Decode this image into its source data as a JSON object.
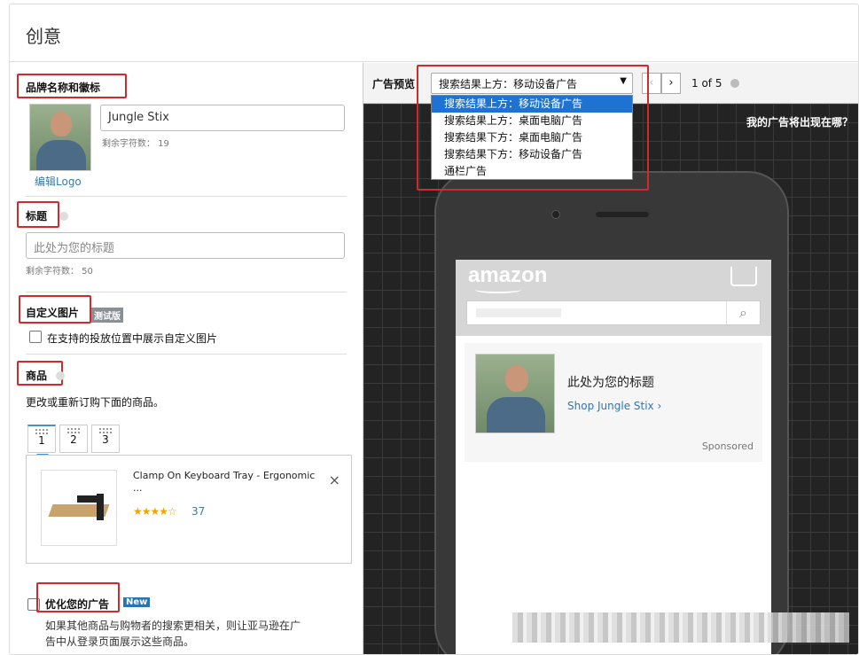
{
  "page": {
    "title": "创意"
  },
  "brand": {
    "label": "品牌名称和徽标",
    "name_value": "Jungle Stix",
    "chars_left": "剩余字符数： 19",
    "edit_logo": "编辑Logo"
  },
  "headline": {
    "label": "标题",
    "placeholder": "此处为您的标题",
    "chars_left": "剩余字符数： 50"
  },
  "custom_image": {
    "label": "自定义图片",
    "badge": "测试版",
    "checkbox_label": "在支持的投放位置中展示自定义图片"
  },
  "products": {
    "label": "商品",
    "hint": "更改或重新订购下面的商品。",
    "tabs": [
      "1",
      "2",
      "3"
    ],
    "item": {
      "title": "Clamp On Keyboard Tray - Ergonomic",
      "ellipsis": "...",
      "rating_count": "37"
    }
  },
  "optimize": {
    "label": "优化您的广告",
    "badge": "New",
    "desc_line1": "如果其他商品与购物者的搜索更相关，则让亚马逊在广",
    "desc_line2": "告中从登录页面展示这些商品。"
  },
  "preview": {
    "label": "广告预览",
    "selected": "搜索结果上方：移动设备广告",
    "options": [
      "搜索结果上方：移动设备广告",
      "搜索结果上方：桌面电脑广告",
      "搜索结果下方：桌面电脑广告",
      "搜索结果下方：移动设备广告",
      "通栏广告"
    ],
    "pager": "1 of 5",
    "where_link": "我的广告将出现在哪？",
    "amazon_logo": "amazon",
    "ad_headline": "此处为您的标题",
    "ad_shop": "Shop Jungle Stix ›",
    "sponsored": "Sponsored"
  },
  "colors": {
    "highlight_red": "#d02a2a",
    "link_blue": "#3a7ba8",
    "selected_option": "#1e73d2",
    "new_badge": "#2a75b0"
  },
  "icons": [
    "info-icon",
    "chevron-left-icon",
    "chevron-right-icon",
    "dropdown-arrow-icon",
    "search-icon",
    "cart-icon",
    "close-icon",
    "star-icon",
    "drag-grip-icon"
  ]
}
